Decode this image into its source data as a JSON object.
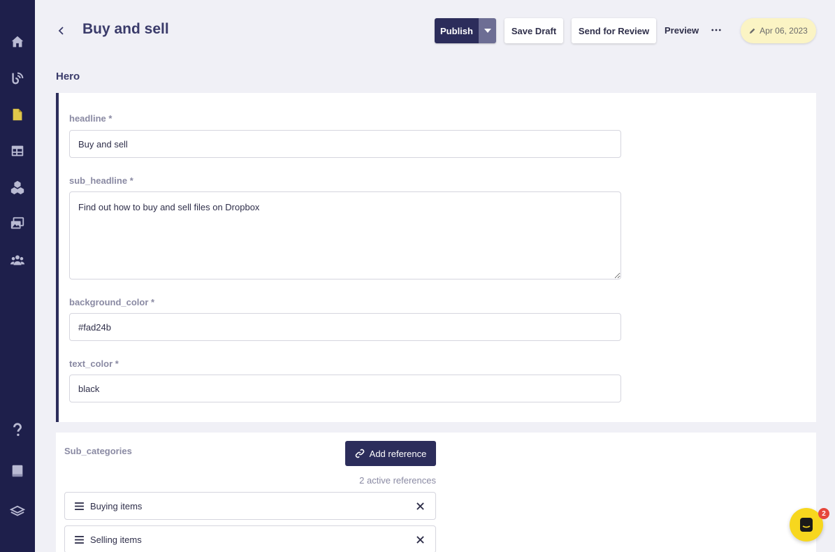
{
  "header": {
    "title": "Buy and sell",
    "publish_label": "Publish",
    "save_draft_label": "Save Draft",
    "send_review_label": "Send for Review",
    "preview_label": "Preview",
    "date": "Apr 06, 2023"
  },
  "sidebar": {
    "items": [
      {
        "icon": "home-icon"
      },
      {
        "icon": "blog-icon"
      },
      {
        "icon": "document-icon",
        "active": true
      },
      {
        "icon": "table-icon"
      },
      {
        "icon": "cubes-icon"
      },
      {
        "icon": "media-icon"
      },
      {
        "icon": "users-icon"
      }
    ],
    "bottom": [
      {
        "icon": "help-icon"
      },
      {
        "icon": "book-icon"
      },
      {
        "icon": "layers-icon"
      }
    ]
  },
  "hero": {
    "heading": "Hero",
    "fields": {
      "headline": {
        "label": "headline *",
        "value": "Buy and sell"
      },
      "sub_headline": {
        "label": "sub_headline *",
        "value": "Find out how to buy and sell files on Dropbox"
      },
      "background_color": {
        "label": "background_color *",
        "value": "#fad24b"
      },
      "text_color": {
        "label": "text_color *",
        "value": "black"
      }
    }
  },
  "sub_categories": {
    "label": "Sub_categories",
    "add_reference_label": "Add reference",
    "active_references": "2 active references",
    "items": [
      {
        "label": "Buying items"
      },
      {
        "label": "Selling items"
      }
    ]
  },
  "chat": {
    "badge": "2"
  },
  "colors": {
    "sidebar": "#1e1f4b",
    "primary": "#2c2d5b",
    "accent_doc": "#e0c74a",
    "chat": "#f7d71e",
    "badge": "#e6473c"
  }
}
